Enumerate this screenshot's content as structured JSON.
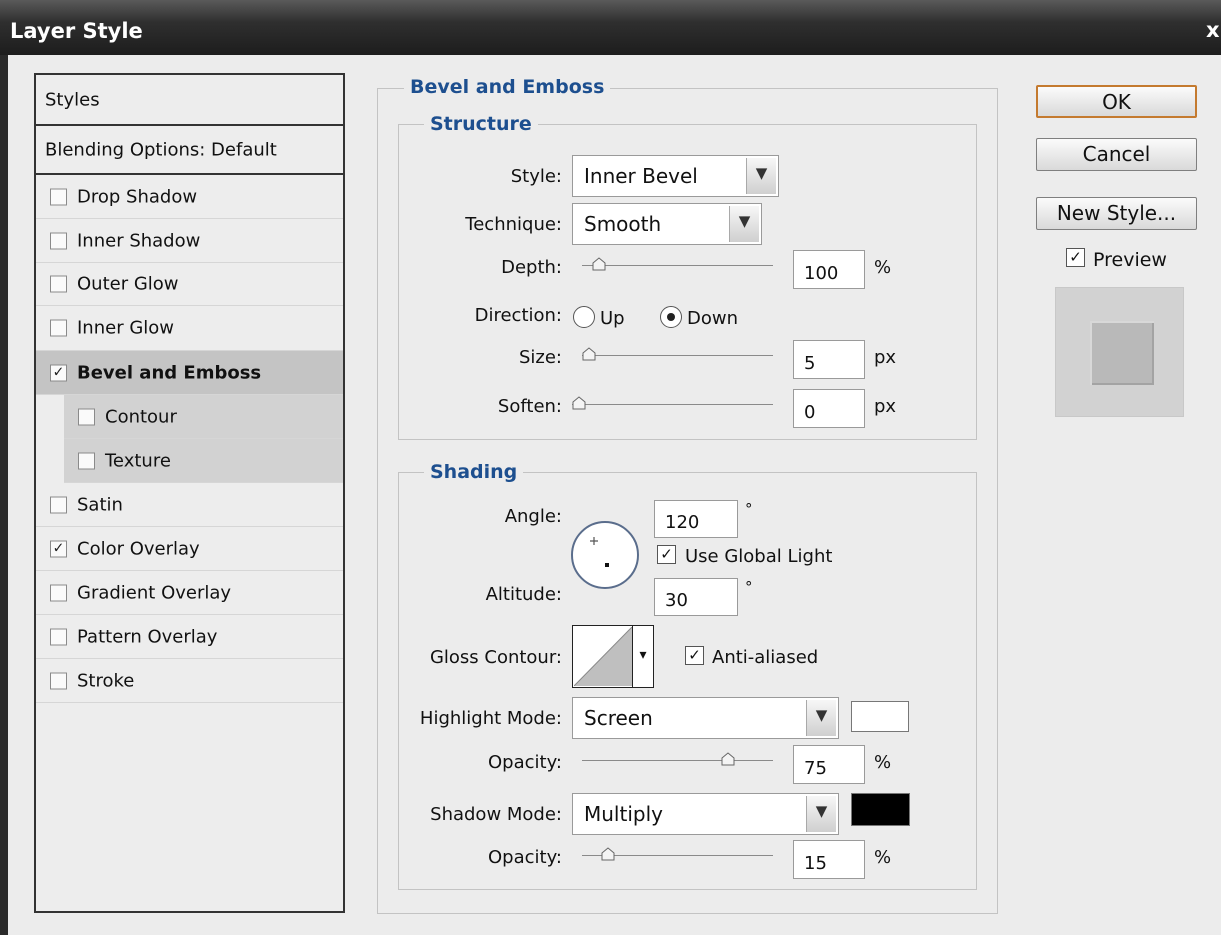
{
  "window": {
    "title": "Layer Style",
    "close_label": "x"
  },
  "styles_list": {
    "header": "Styles",
    "blending": "Blending Options: Default",
    "items": [
      {
        "label": "Drop Shadow",
        "checked": false
      },
      {
        "label": "Inner Shadow",
        "checked": false
      },
      {
        "label": "Outer Glow",
        "checked": false
      },
      {
        "label": "Inner Glow",
        "checked": false
      },
      {
        "label": "Bevel and Emboss",
        "checked": true,
        "selected": true
      },
      {
        "label": "Contour",
        "checked": false,
        "sub": true
      },
      {
        "label": "Texture",
        "checked": false,
        "sub": true
      },
      {
        "label": "Satin",
        "checked": false
      },
      {
        "label": "Color Overlay",
        "checked": true
      },
      {
        "label": "Gradient Overlay",
        "checked": false
      },
      {
        "label": "Pattern Overlay",
        "checked": false
      },
      {
        "label": "Stroke",
        "checked": false
      }
    ]
  },
  "bevel": {
    "title": "Bevel and Emboss",
    "structure": {
      "title": "Structure",
      "style_label": "Style:",
      "style_value": "Inner Bevel",
      "technique_label": "Technique:",
      "technique_value": "Smooth",
      "depth_label": "Depth:",
      "depth_value": "100",
      "depth_unit": "%",
      "direction_label": "Direction:",
      "direction_up": "Up",
      "direction_down": "Down",
      "direction_selected": "Down",
      "size_label": "Size:",
      "size_value": "5",
      "size_unit": "px",
      "soften_label": "Soften:",
      "soften_value": "0",
      "soften_unit": "px"
    },
    "shading": {
      "title": "Shading",
      "angle_label": "Angle:",
      "angle_value": "120",
      "degree_symbol": "°",
      "use_global_light_label": "Use Global Light",
      "use_global_light_checked": true,
      "altitude_label": "Altitude:",
      "altitude_value": "30",
      "gloss_contour_label": "Gloss Contour:",
      "anti_aliased_label": "Anti-aliased",
      "anti_aliased_checked": true,
      "highlight_mode_label": "Highlight Mode:",
      "highlight_mode_value": "Screen",
      "highlight_color": "#ffffff",
      "highlight_opacity_label": "Opacity:",
      "highlight_opacity_value": "75",
      "highlight_opacity_unit": "%",
      "shadow_mode_label": "Shadow Mode:",
      "shadow_mode_value": "Multiply",
      "shadow_color": "#000000",
      "shadow_opacity_label": "Opacity:",
      "shadow_opacity_value": "15",
      "shadow_opacity_unit": "%"
    }
  },
  "buttons": {
    "ok": "OK",
    "cancel": "Cancel",
    "new_style": "New Style...",
    "preview_label": "Preview",
    "preview_checked": true
  },
  "colors": {
    "accent": "#1d4f8f",
    "ok_border": "#c47a2f"
  }
}
